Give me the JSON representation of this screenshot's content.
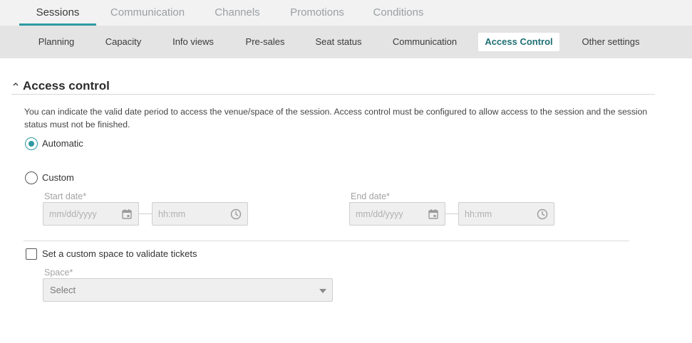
{
  "top_tabs": [
    {
      "label": "Sessions",
      "active": true
    },
    {
      "label": "Communication",
      "active": false
    },
    {
      "label": "Channels",
      "active": false
    },
    {
      "label": "Promotions",
      "active": false
    },
    {
      "label": "Conditions",
      "active": false
    }
  ],
  "sub_tabs": [
    {
      "label": "Planning"
    },
    {
      "label": "Capacity"
    },
    {
      "label": "Info views"
    },
    {
      "label": "Pre-sales"
    },
    {
      "label": "Seat status"
    },
    {
      "label": "Communication"
    },
    {
      "label": "Access Control",
      "active": true
    },
    {
      "label": "Other settings"
    }
  ],
  "section": {
    "title": "Access control",
    "description": "You can indicate the valid date period to access the venue/space of the session. Access control must be configured to allow access to the session and the session status must not be finished."
  },
  "options": {
    "automatic_label": "Automatic",
    "automatic_checked": true,
    "custom_label": "Custom",
    "custom_checked": false
  },
  "start": {
    "label": "Start date*",
    "date_placeholder": "mm/dd/yyyy",
    "time_placeholder": "hh:mm"
  },
  "end": {
    "label": "End date*",
    "date_placeholder": "mm/dd/yyyy",
    "time_placeholder": "hh:mm"
  },
  "custom_space": {
    "checkbox_label": "Set a custom space to validate tickets",
    "checked": false,
    "space_label": "Space*",
    "select_value": "Select"
  },
  "colors": {
    "accent": "#2e9aa0",
    "active_sub_tab_text": "#1f6f73"
  },
  "icons": [
    "chevron-up-icon",
    "calendar-icon",
    "clock-icon",
    "caret-down-icon"
  ]
}
